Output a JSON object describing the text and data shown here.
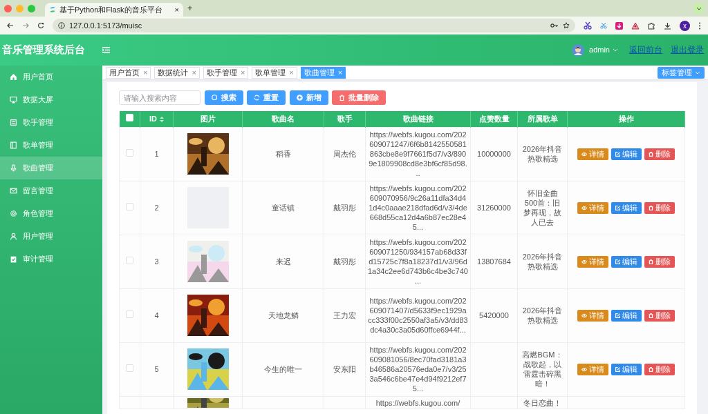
{
  "browser": {
    "tab_title": "基于Python和Flask的音乐平台",
    "tab_close": "×",
    "new_tab": "+",
    "url": "127.0.0.1:5173/muisc",
    "profile": "x"
  },
  "header": {
    "title": "音乐管理系统后台",
    "user": "admin",
    "links": [
      "返回前台",
      "退出登录"
    ]
  },
  "sidebar": {
    "items": [
      {
        "label": "用户首页",
        "selected": false
      },
      {
        "label": "数据大屏",
        "selected": false
      },
      {
        "label": "歌手管理",
        "selected": false
      },
      {
        "label": "歌单管理",
        "selected": false
      },
      {
        "label": "歌曲管理",
        "selected": true
      },
      {
        "label": "留言管理",
        "selected": false
      },
      {
        "label": "角色管理",
        "selected": false
      },
      {
        "label": "用户管理",
        "selected": false
      },
      {
        "label": "审计管理",
        "selected": false
      }
    ]
  },
  "tags": [
    {
      "label": "用户首页",
      "selected": false
    },
    {
      "label": "数据统计",
      "selected": false
    },
    {
      "label": "歌手管理",
      "selected": false
    },
    {
      "label": "歌单管理",
      "selected": false
    },
    {
      "label": "歌曲管理",
      "selected": true
    }
  ],
  "tag_close": "×",
  "tag_menu": "标签管理",
  "search": {
    "placeholder": "请输入搜索内容"
  },
  "toolbar": [
    {
      "label": "搜索",
      "kind": "search"
    },
    {
      "label": "重置",
      "kind": "reset"
    },
    {
      "label": "新增",
      "kind": "add"
    },
    {
      "label": "批量删除",
      "kind": "batch-delete"
    }
  ],
  "table": {
    "select_all": false,
    "columns": [
      "ID",
      "图片",
      "歌曲名",
      "歌手",
      "歌曲链接",
      "点赞数量",
      "所属歌单",
      "操作"
    ],
    "rows": [
      {
        "checked": false,
        "id": "1",
        "cover": {
          "kind": "picture"
        },
        "name": "稻香",
        "singer": "周杰伦",
        "link": "https://webfs.kugou.com/202609071247/6f6b8142550581863cbe8e9f7661f5d7/v3/8909e1809908cd8e3bf6cf85d98...",
        "likes": "10000000",
        "playlist": "2026年抖音热歌精选",
        "actions": [
          "详情",
          "编辑",
          "删除"
        ]
      },
      {
        "checked": false,
        "id": "2",
        "cover": {
          "kind": "empty"
        },
        "name": "童话镇",
        "singer": "戴羽彤",
        "link": "https://webfs.kugou.com/202609070956/9c26a11dfa34d41d4c0aaae218dfad6d/v3/4de668d55ca12d4a6b87ec28e45...",
        "likes": "31260000",
        "playlist": "怀旧金曲500首：旧梦再现，故人已去",
        "actions": [
          "详情",
          "编辑",
          "删除"
        ]
      },
      {
        "checked": false,
        "id": "3",
        "cover": {
          "kind": "picture"
        },
        "name": "来迟",
        "singer": "戴羽彤",
        "link": "https://webfs.kugou.com/202609071250/934157ab68d33fd15725c7f8a18237d1/v3/96d1a34c2ee6d743b6c4be3c740...",
        "likes": "13807684",
        "playlist": "2026年抖音热歌精选",
        "actions": [
          "详情",
          "编辑",
          "删除"
        ]
      },
      {
        "checked": false,
        "id": "4",
        "cover": {
          "kind": "picture"
        },
        "name": "天地龙鳞",
        "singer": "王力宏",
        "link": "https://webfs.kugou.com/202609071407/d5633f9ec1929acc333f00c2550af3a5/v3/dd83dc4a30c3a05d60ffce6944f...",
        "likes": "5420000",
        "playlist": "2026年抖音热歌精选",
        "actions": [
          "详情",
          "编辑",
          "删除"
        ]
      },
      {
        "checked": false,
        "id": "5",
        "cover": {
          "kind": "picture"
        },
        "name": "今生的唯一",
        "singer": "安东阳",
        "link": "https://webfs.kugou.com/202609081056/8ec70fad3181a3b46586a20576eda0e7/v3/253a546c6be47e4d94f9212ef75...",
        "playlist": "高燃BGM：战歌起，以雷霆击碎黑暗！",
        "actions": [
          "详情",
          "编辑",
          "删除"
        ]
      },
      {
        "cover": {
          "kind": "picture"
        },
        "link": "https://webfs.kugou.com/",
        "playlist": "冬日恋曲！"
      }
    ]
  }
}
